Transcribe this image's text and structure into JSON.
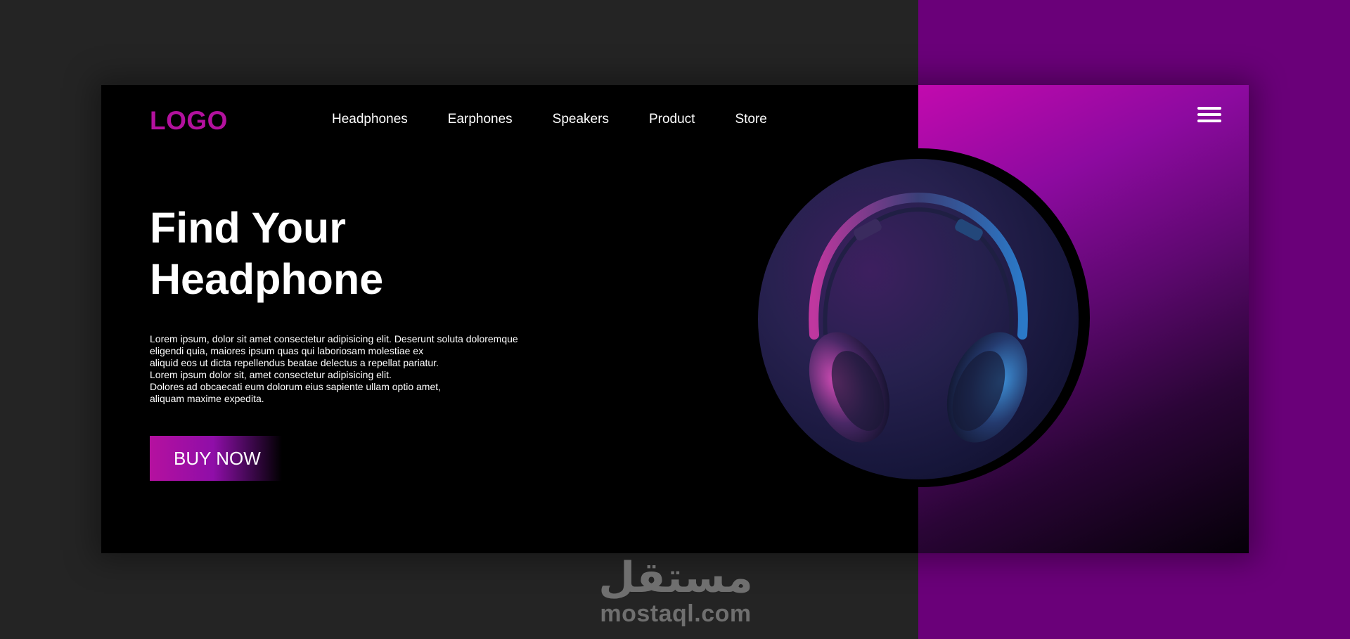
{
  "header": {
    "logo": "LOGO",
    "nav": [
      "Headphones",
      "Earphones",
      "Speakers",
      "Product",
      "Store"
    ]
  },
  "hero": {
    "title_lines": [
      "Find Your",
      "Headphone"
    ],
    "description_lines": [
      "Lorem ipsum, dolor sit amet consectetur adipisicing elit. Deserunt soluta doloremque",
      "eligendi quia, maiores ipsum quas qui laboriosam molestiae ex",
      "aliquid eos ut dicta repellendus beatae delectus a repellat pariatur.",
      "Lorem ipsum dolor sit, amet consectetur adipisicing elit.",
      "Dolores ad obcaecati eum dolorum eius sapiente ullam optio amet,",
      "aliquam maxime expedita."
    ],
    "cta": "BUY NOW"
  },
  "watermark": {
    "arabic": "مستقل",
    "latin": "mostaql.com"
  },
  "icons": {
    "menu": "hamburger-menu-icon",
    "image": "headphones-image"
  },
  "colors": {
    "page_background": "#242424",
    "side_purple": "#6a0079",
    "accent": "#b3119e",
    "card": "#000000"
  }
}
